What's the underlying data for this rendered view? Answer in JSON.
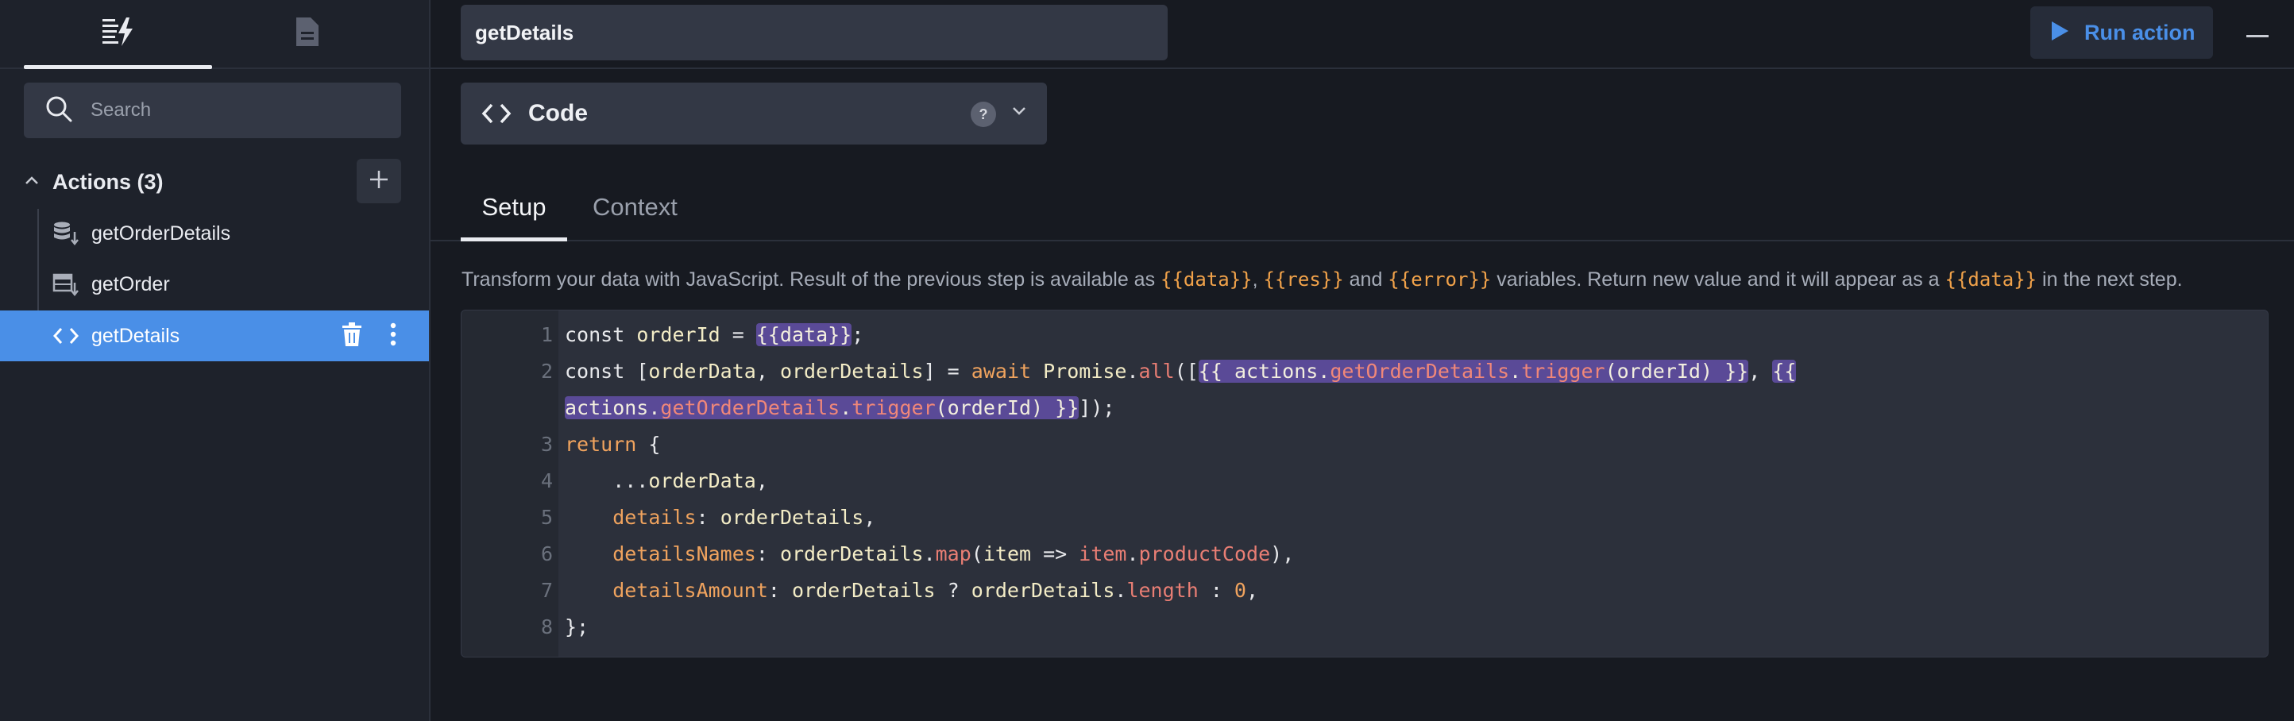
{
  "sidebar": {
    "search_placeholder": "Search",
    "section_title": "Actions (3)",
    "items": [
      {
        "label": "getOrderDetails",
        "icon": "database-icon"
      },
      {
        "label": "getOrder",
        "icon": "table-icon"
      },
      {
        "label": "getDetails",
        "icon": "code-icon"
      }
    ]
  },
  "topbar": {
    "action_name": "getDetails",
    "run_label": "Run action"
  },
  "type_selector": {
    "label": "Code",
    "help": "?"
  },
  "tabs": [
    {
      "label": "Setup"
    },
    {
      "label": "Context"
    }
  ],
  "description": {
    "p1": "Transform your data with JavaScript. Result of the previous step is available as ",
    "v1": "{{data}}",
    "p2": ", ",
    "v2": "{{res}}",
    "p3": " and ",
    "v3": "{{error}}",
    "p4": " variables. Return new value and it will appear as a ",
    "v4": "{{data}}",
    "p5": " in the next step."
  },
  "editor": {
    "line_numbers": [
      "1",
      "2",
      "",
      "3",
      "4",
      "5",
      "6",
      "7",
      "8"
    ],
    "l1": {
      "a": "const ",
      "b": "orderId",
      "c": " = ",
      "d": "{{data}}",
      "e": ";"
    },
    "l2": {
      "a": "const ",
      "b": "[",
      "c": "orderData",
      "d": ", ",
      "e": "orderDetails",
      "f": "] = ",
      "g": "await ",
      "h": "Promise",
      "i": ".",
      "j": "all",
      "k": "([",
      "l": "{{ actions.",
      "m": "getOrderDetails",
      "n": ".",
      "o": "trigger",
      "p": "(orderId) }}",
      "q": ", ",
      "r": "{{"
    },
    "l2b": {
      "a": "actions",
      "b": ".",
      "c": "getOrderDetails",
      "d": ".",
      "e": "trigger",
      "f": "(orderId) }}",
      "g": "]);"
    },
    "l3": {
      "a": "return",
      "b": " {"
    },
    "l4": {
      "a": "    ...",
      "b": "orderData",
      "c": ","
    },
    "l5": {
      "a": "    details",
      "b": ": ",
      "c": "orderDetails",
      "d": ","
    },
    "l6": {
      "a": "    detailsNames",
      "b": ": ",
      "c": "orderDetails",
      "d": ".",
      "e": "map",
      "f": "(",
      "g": "item",
      "h": " => ",
      "i": "item",
      "j": ".",
      "k": "productCode",
      "l": "),"
    },
    "l7": {
      "a": "    detailsAmount",
      "b": ": ",
      "c": "orderDetails",
      "d": " ? ",
      "e": "orderDetails",
      "f": ".",
      "g": "length",
      "h": " : ",
      "i": "0",
      "j": ","
    },
    "l8": {
      "a": "};"
    }
  },
  "colors": {
    "accent": "#4a8fe7",
    "highlight": "#5a4a97",
    "template_var": "#f1a24a"
  }
}
